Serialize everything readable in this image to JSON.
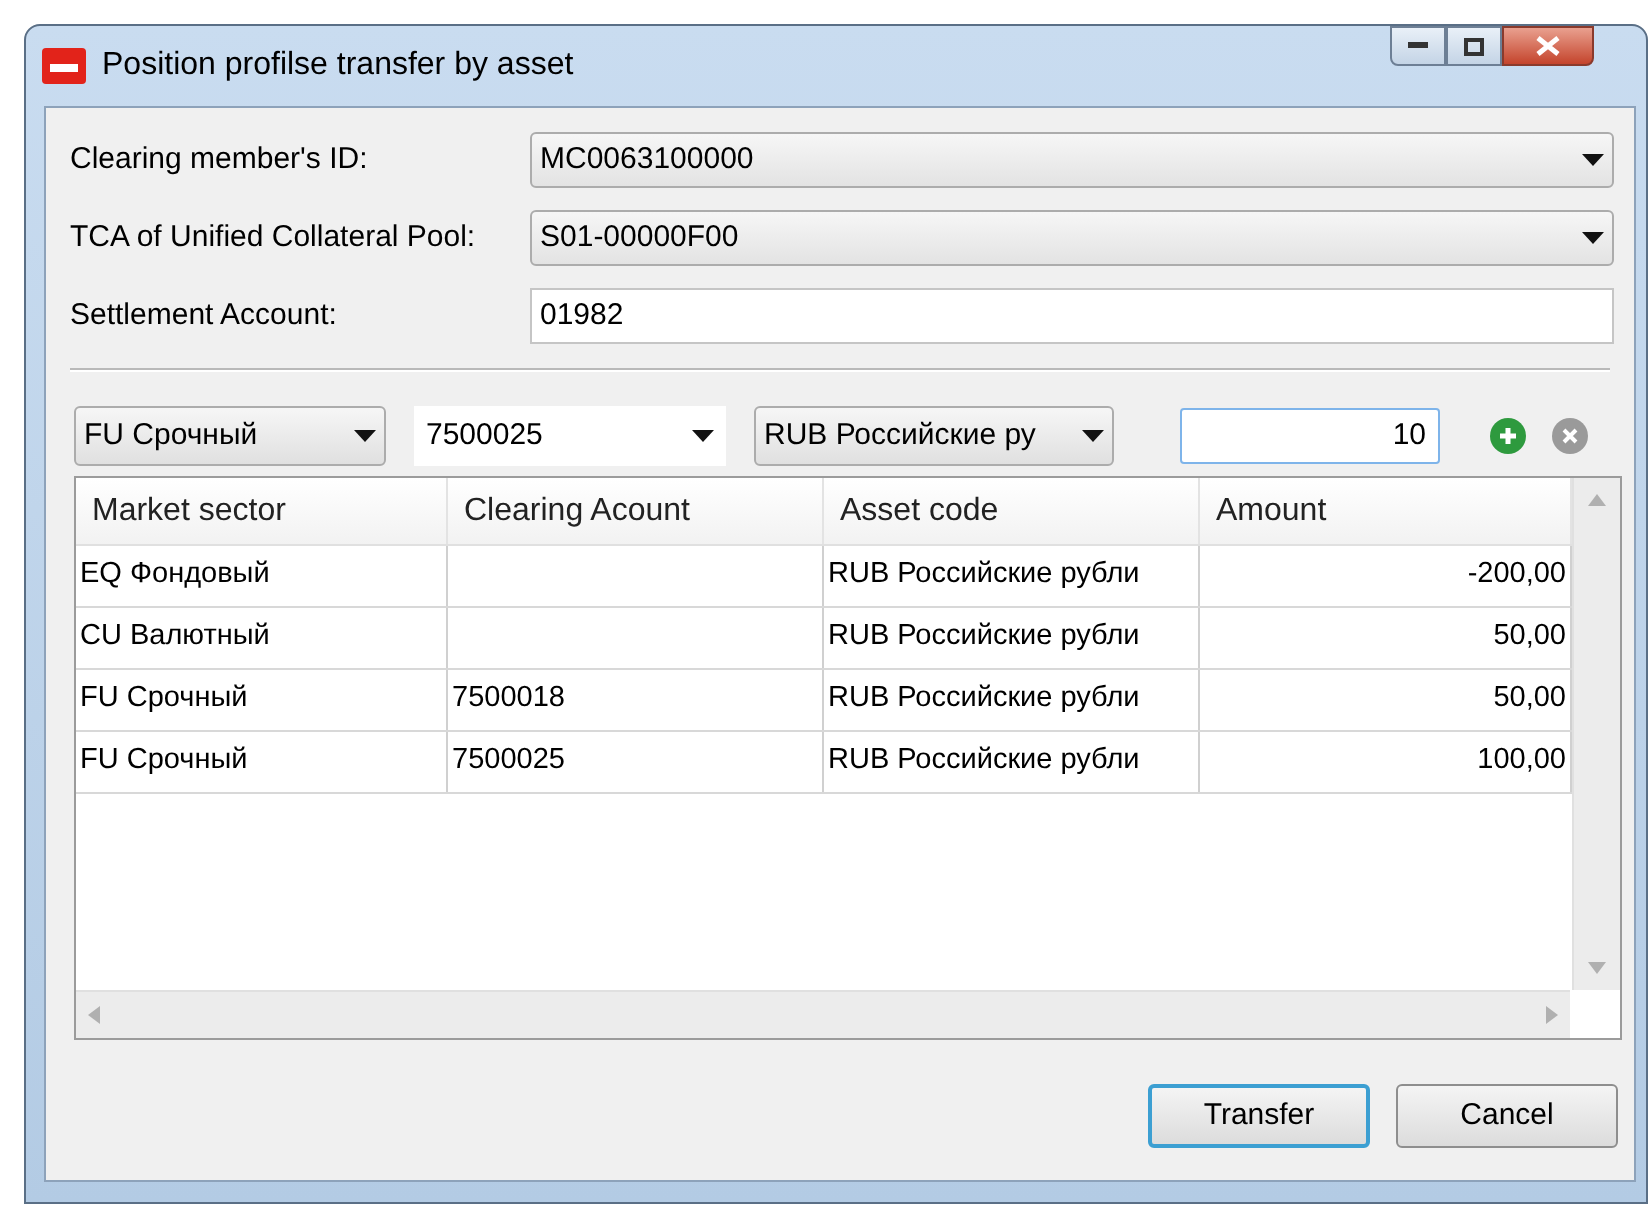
{
  "window": {
    "title": "Position profilse transfer by asset"
  },
  "fields": [
    {
      "label": "Clearing member's ID:",
      "value": "MC0063100000",
      "kind": "dropdown"
    },
    {
      "label": "TCA of Unified Collateral Pool:",
      "value": "S01-00000F00",
      "kind": "dropdown"
    },
    {
      "label": "Settlement Account:",
      "value": "01982",
      "kind": "text"
    }
  ],
  "filters": [
    {
      "value": "FU Срочный",
      "kind": "dropdown"
    },
    {
      "value": "7500025",
      "kind": "editable"
    },
    {
      "value": "RUB Российские ру",
      "kind": "dropdown"
    },
    {
      "value": "10",
      "kind": "amount"
    }
  ],
  "table": {
    "columns": [
      "Market sector",
      "Clearing Acount",
      "Asset code",
      "Amount"
    ],
    "rows": [
      [
        "EQ Фондовый",
        "",
        "RUB Российские рубли",
        "-200,00"
      ],
      [
        "CU Валютный",
        "",
        "RUB Российские рубли",
        "50,00"
      ],
      [
        "FU Срочный",
        "7500018",
        "RUB Российские рубли",
        "50,00"
      ],
      [
        "FU Срочный",
        "7500025",
        "RUB Российские рубли",
        "100,00"
      ]
    ]
  },
  "buttons": [
    {
      "label": "Transfer",
      "focused": true
    },
    {
      "label": "Cancel",
      "focused": false
    }
  ]
}
